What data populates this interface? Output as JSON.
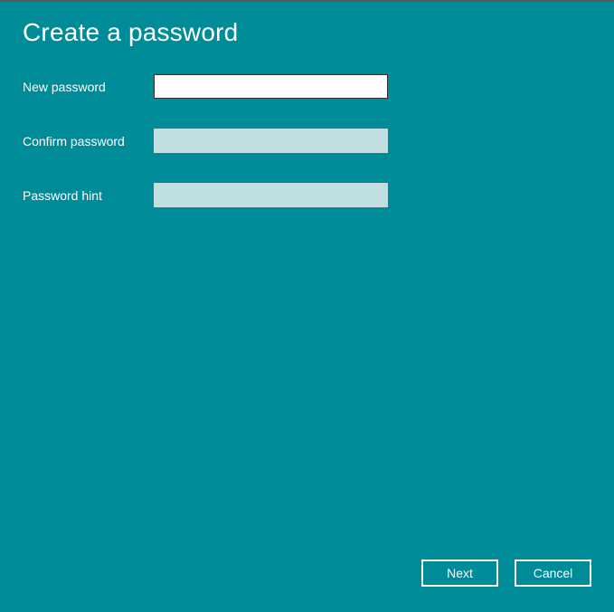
{
  "header": {
    "title": "Create a password"
  },
  "form": {
    "new_password": {
      "label": "New password",
      "value": ""
    },
    "confirm_password": {
      "label": "Confirm password",
      "value": ""
    },
    "password_hint": {
      "label": "Password hint",
      "value": ""
    }
  },
  "buttons": {
    "next_label": "Next",
    "cancel_label": "Cancel"
  }
}
